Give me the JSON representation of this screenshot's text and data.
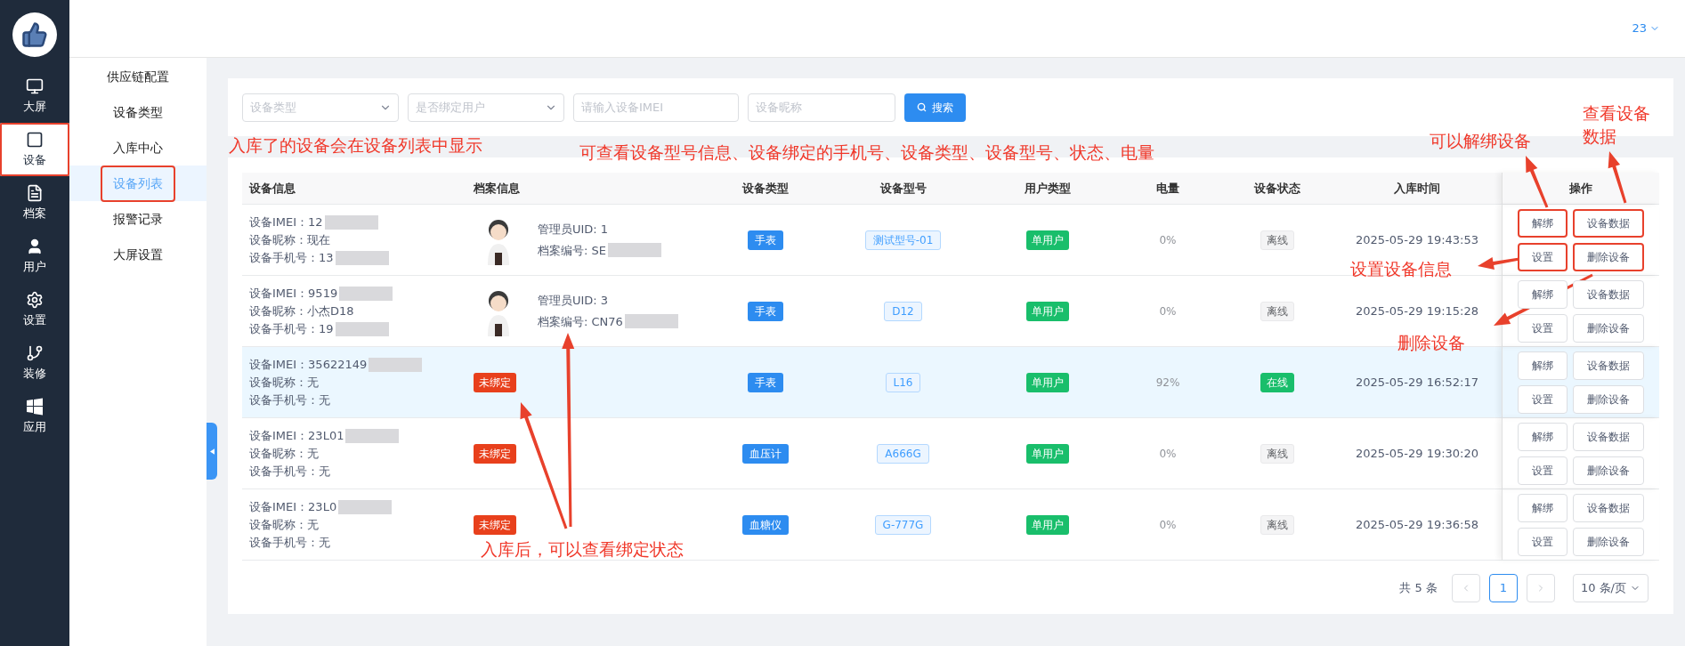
{
  "nav": {
    "items": [
      {
        "label": "大屏",
        "selected": false,
        "annotated": false
      },
      {
        "label": "设备",
        "selected": true,
        "annotated": true
      },
      {
        "label": "档案",
        "selected": false,
        "annotated": false
      },
      {
        "label": "用户",
        "selected": false,
        "annotated": false
      },
      {
        "label": "设置",
        "selected": false,
        "annotated": false
      },
      {
        "label": "装修",
        "selected": false,
        "annotated": false
      },
      {
        "label": "应用",
        "selected": false,
        "annotated": false
      }
    ]
  },
  "header": {
    "user": "23"
  },
  "menu": {
    "items": [
      {
        "label": "供应链配置",
        "selected": false,
        "annotated": false
      },
      {
        "label": "设备类型",
        "selected": false,
        "annotated": false
      },
      {
        "label": "入库中心",
        "selected": false,
        "annotated": false
      },
      {
        "label": "设备列表",
        "selected": true,
        "annotated": true
      },
      {
        "label": "报警记录",
        "selected": false,
        "annotated": false
      },
      {
        "label": "大屏设置",
        "selected": false,
        "annotated": false
      }
    ]
  },
  "filters": {
    "device_type": {
      "placeholder": "设备类型"
    },
    "bind_user": {
      "placeholder": "是否绑定用户"
    },
    "imei": {
      "placeholder": "请输入设备IMEI"
    },
    "nickname": {
      "placeholder": "设备昵称"
    },
    "search_button": "搜索"
  },
  "table": {
    "columns": [
      "设备信息",
      "档案信息",
      "设备类型",
      "设备型号",
      "用户类型",
      "电量",
      "设备状态",
      "入库时间",
      "操作"
    ],
    "rows": [
      {
        "highlighted": false,
        "imei": "设备IMEI：12",
        "imei_masked": true,
        "nickname": "设备昵称：现在",
        "phone": "设备手机号：13",
        "phone_masked": true,
        "archive": {
          "kind": "profile",
          "uid": "管理员UID: 1",
          "number": "档案编号: SE",
          "number_masked": true
        },
        "device_type": "手表",
        "model": "测试型号-01",
        "user_type": "单用户",
        "battery": "0%",
        "status": {
          "label": "离线",
          "online": false
        },
        "time": "2025-05-29 19:43:53",
        "actions": [
          {
            "label": "解绑",
            "annotated": true
          },
          {
            "label": "设备数据",
            "annotated": true
          },
          {
            "label": "设置",
            "annotated": true
          },
          {
            "label": "删除设备",
            "annotated": true
          }
        ]
      },
      {
        "highlighted": false,
        "imei": "设备IMEI：9519",
        "imei_masked": true,
        "nickname": "设备昵称：小杰D18",
        "phone": "设备手机号：19",
        "phone_masked": true,
        "archive": {
          "kind": "profile",
          "uid": "管理员UID: 3",
          "number": "档案编号: CN76",
          "number_masked": true
        },
        "device_type": "手表",
        "model": "D12",
        "user_type": "单用户",
        "battery": "0%",
        "status": {
          "label": "离线",
          "online": false
        },
        "time": "2025-05-29 19:15:28",
        "actions": [
          {
            "label": "解绑",
            "annotated": false
          },
          {
            "label": "设备数据",
            "annotated": false
          },
          {
            "label": "设置",
            "annotated": false
          },
          {
            "label": "删除设备",
            "annotated": false
          }
        ]
      },
      {
        "highlighted": true,
        "imei": "设备IMEI：35622149",
        "imei_masked": true,
        "nickname": "设备昵称：无",
        "phone": "设备手机号：无",
        "phone_masked": false,
        "archive": {
          "kind": "unbound",
          "label": "未绑定"
        },
        "device_type": "手表",
        "model": "L16",
        "user_type": "单用户",
        "battery": "92%",
        "status": {
          "label": "在线",
          "online": true
        },
        "time": "2025-05-29 16:52:17",
        "actions": [
          {
            "label": "解绑",
            "annotated": false
          },
          {
            "label": "设备数据",
            "annotated": false
          },
          {
            "label": "设置",
            "annotated": false
          },
          {
            "label": "删除设备",
            "annotated": false
          }
        ]
      },
      {
        "highlighted": false,
        "imei": "设备IMEI：23L01",
        "imei_masked": true,
        "nickname": "设备昵称：无",
        "phone": "设备手机号：无",
        "phone_masked": false,
        "archive": {
          "kind": "unbound",
          "label": "未绑定"
        },
        "device_type": "血压计",
        "model": "A666G",
        "user_type": "单用户",
        "battery": "0%",
        "status": {
          "label": "离线",
          "online": false
        },
        "time": "2025-05-29 19:30:20",
        "actions": [
          {
            "label": "解绑",
            "annotated": false
          },
          {
            "label": "设备数据",
            "annotated": false
          },
          {
            "label": "设置",
            "annotated": false
          },
          {
            "label": "删除设备",
            "annotated": false
          }
        ]
      },
      {
        "highlighted": false,
        "imei": "设备IMEI：23L0",
        "imei_masked": true,
        "nickname": "设备昵称：无",
        "phone": "设备手机号：无",
        "phone_masked": false,
        "archive": {
          "kind": "unbound",
          "label": "未绑定"
        },
        "device_type": "血糖仪",
        "model": "G-777G",
        "user_type": "单用户",
        "battery": "0%",
        "status": {
          "label": "离线",
          "online": false
        },
        "time": "2025-05-29 19:36:58",
        "actions": [
          {
            "label": "解绑",
            "annotated": false
          },
          {
            "label": "设备数据",
            "annotated": false
          },
          {
            "label": "设置",
            "annotated": false
          },
          {
            "label": "删除设备",
            "annotated": false
          }
        ]
      }
    ]
  },
  "pagination": {
    "total": "共 5 条",
    "pages": [
      {
        "label": "1",
        "selected": true
      }
    ],
    "page_size": "10 条/页"
  },
  "annotations": [
    {
      "text": "入库了的设备会在设备列表中显示"
    },
    {
      "text": "可查看设备型号信息、设备绑定的手机号、设备类型、设备型号、状态、电量"
    },
    {
      "text": "可以解绑设备"
    },
    {
      "text": "查看设备数据"
    },
    {
      "text": "设置设备信息"
    },
    {
      "text": "删除设备"
    },
    {
      "text": "入库后，可以查看绑定状态"
    }
  ]
}
